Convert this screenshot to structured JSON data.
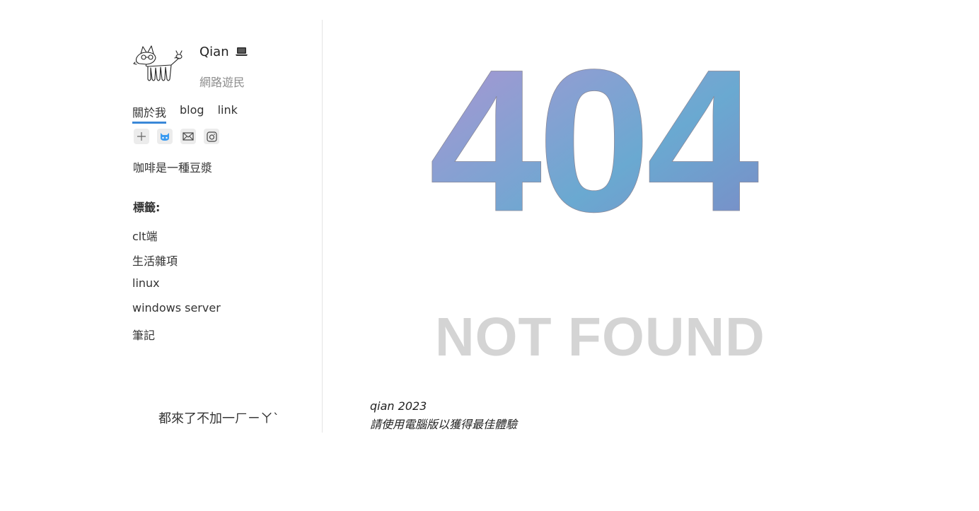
{
  "sidebar": {
    "site_name": "Qian",
    "site_subtitle": "網路遊民",
    "nav": [
      {
        "label": "關於我",
        "active": true
      },
      {
        "label": "blog",
        "active": false
      },
      {
        "label": "link",
        "active": false
      }
    ],
    "social_icons": [
      "plus-icon",
      "github-icon",
      "mail-icon",
      "instagram-icon"
    ],
    "tagline": "咖啡是一種豆漿",
    "tags_title": "標籤:",
    "tags": [
      "clt端",
      "生活雜項",
      "linux",
      "windows server",
      "筆記"
    ],
    "footer_text": "都來了不加一ㄏㄧㄚˋ"
  },
  "main": {
    "error_code": "404",
    "error_text": "NOT FOUND",
    "gradient_colors": [
      "#b393d3",
      "#6aa9d1",
      "#7d87c5"
    ]
  },
  "footer": {
    "copyright": "qian 2023",
    "notice": "請使用電腦版以獲得最佳體驗"
  }
}
